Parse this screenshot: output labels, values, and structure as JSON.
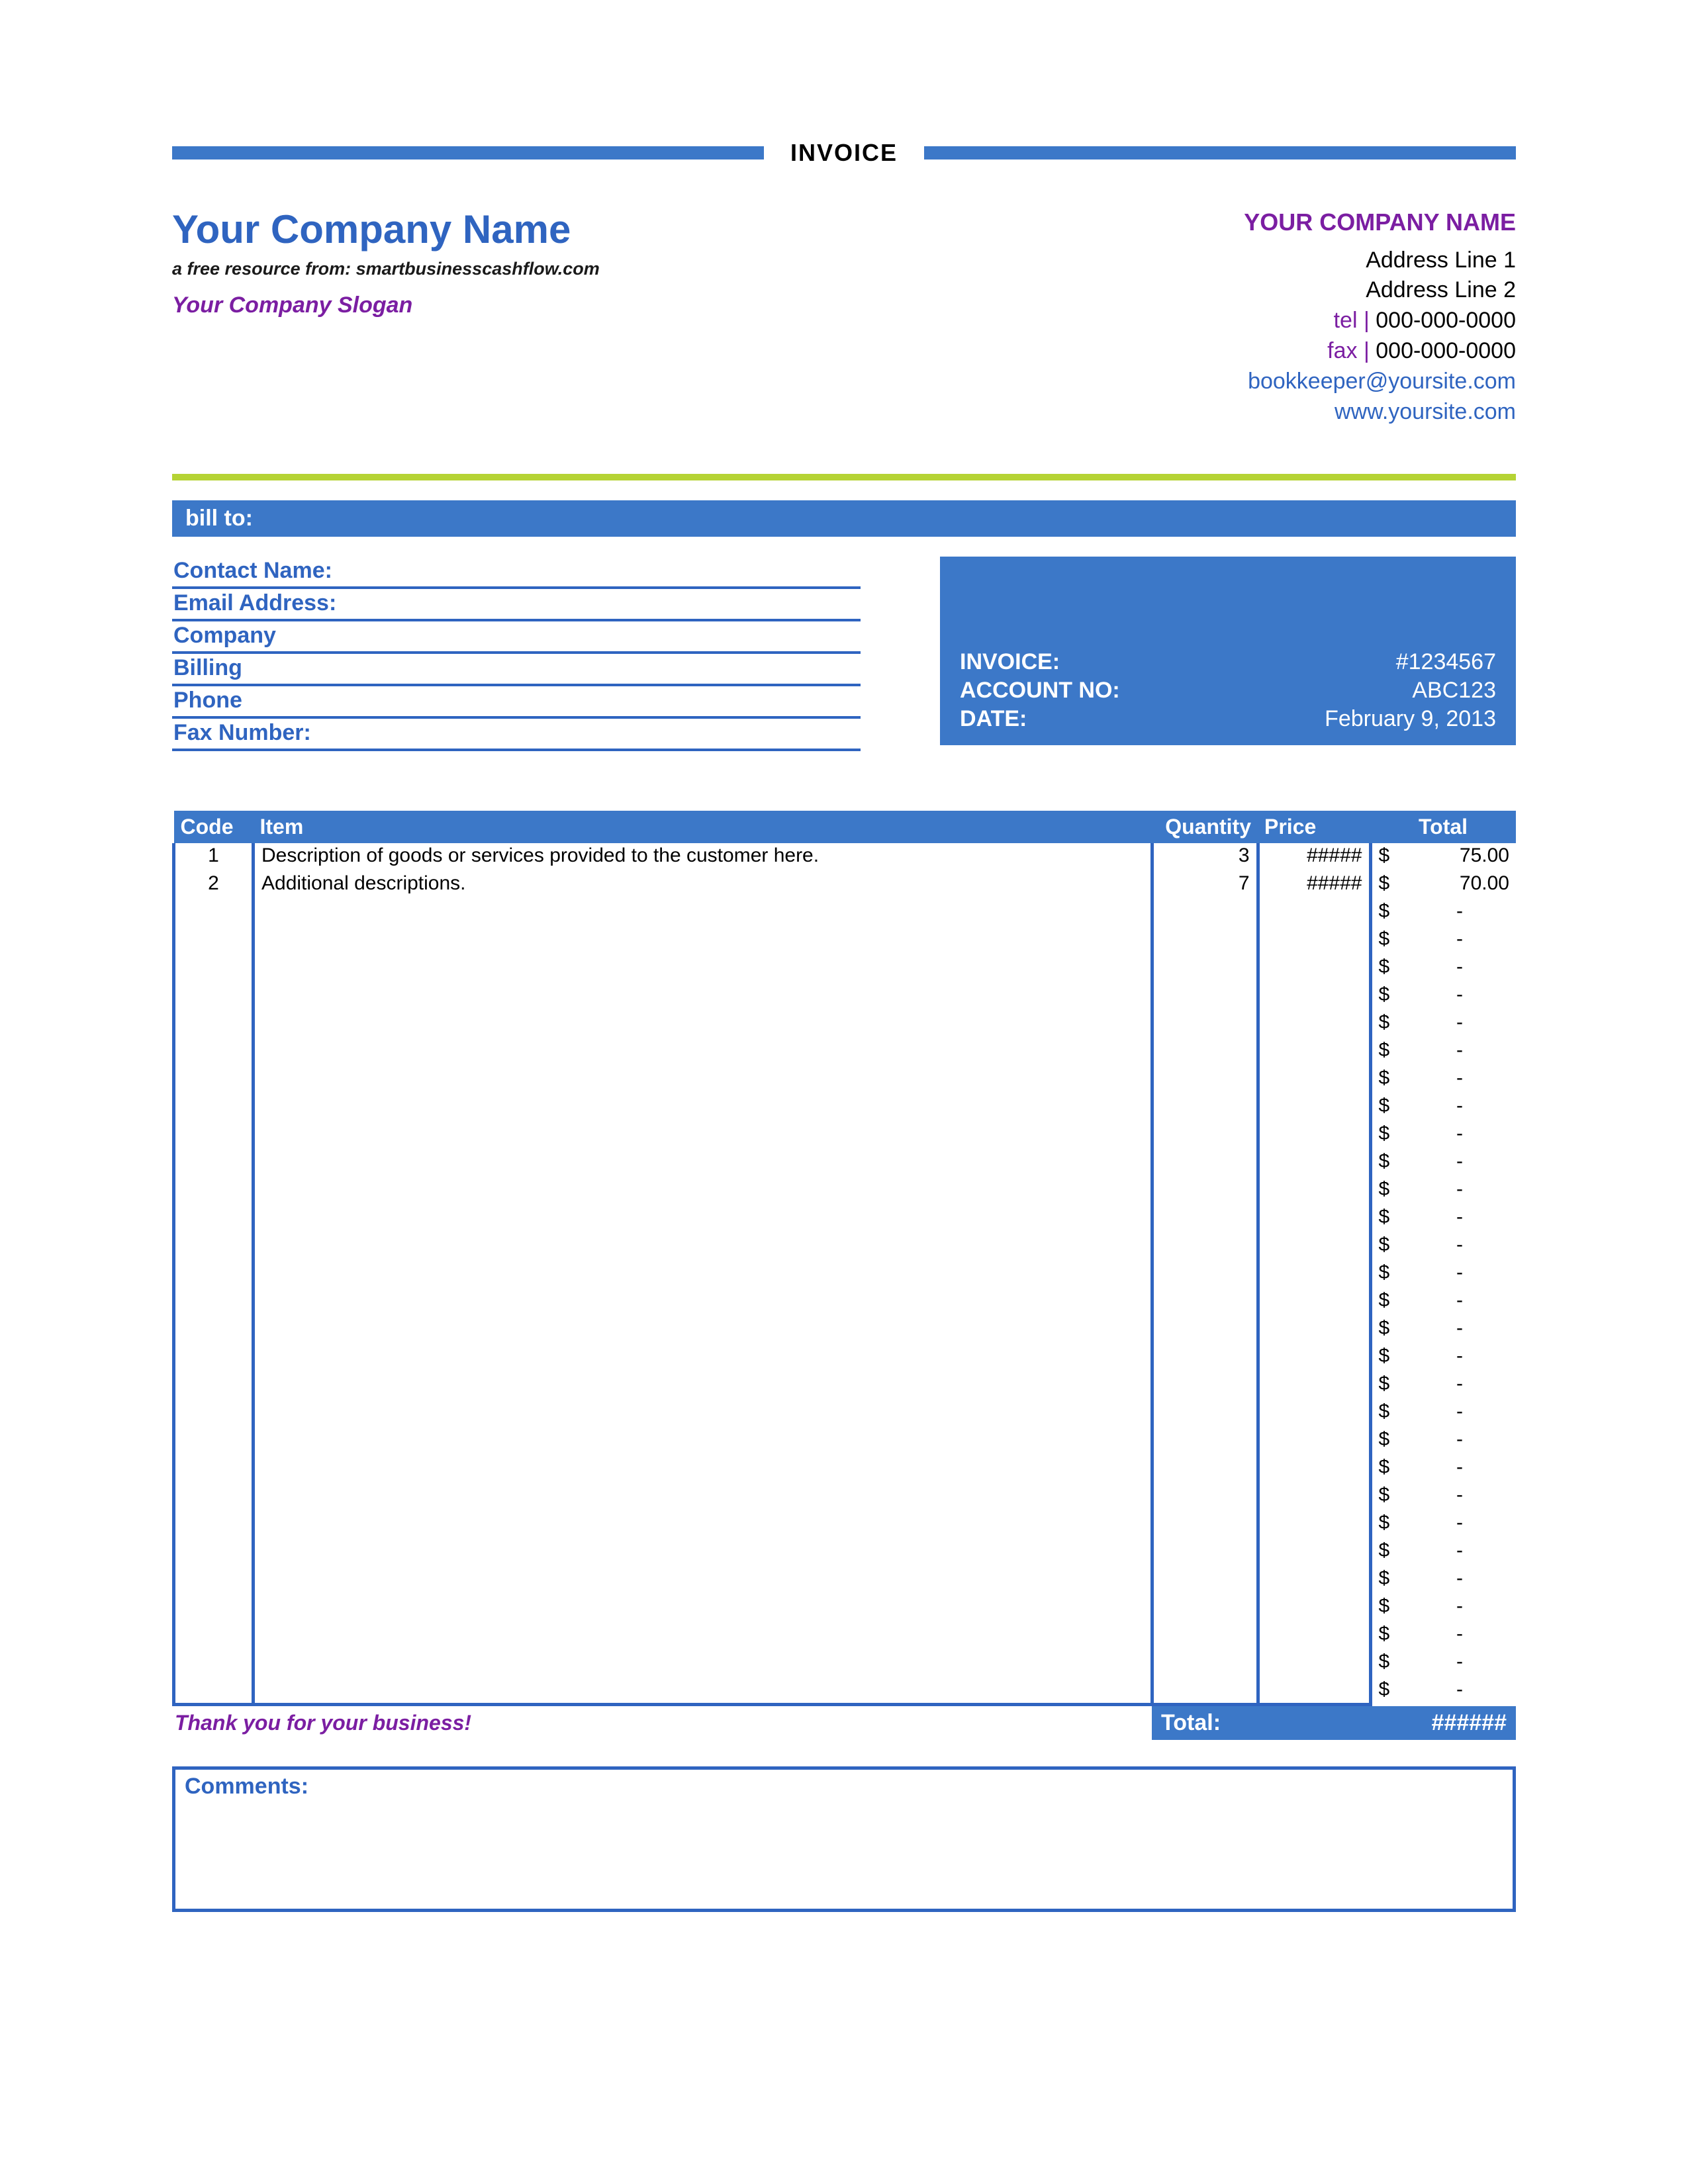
{
  "top_title": "INVOICE",
  "header": {
    "company_name": "Your Company Name",
    "resource_line": "a free resource from: smartbusinesscashflow.com",
    "slogan": "Your Company Slogan",
    "right_company": "YOUR COMPANY NAME",
    "address1": "Address Line 1",
    "address2": "Address Line 2",
    "tel_label": "tel",
    "tel": "000-000-0000",
    "fax_label": "fax",
    "fax": "000-000-0000",
    "email": "bookkeeper@yoursite.com",
    "website": "www.yoursite.com"
  },
  "billto_label": "bill to:",
  "bill_fields": [
    "Contact Name:",
    "Email Address:",
    "Company",
    "Billing",
    "Phone",
    "Fax Number:"
  ],
  "invoice_info": {
    "invoice_label": "INVOICE:",
    "invoice_value": "#1234567",
    "account_label": "ACCOUNT NO:",
    "account_value": "ABC123",
    "date_label": "DATE:",
    "date_value": "February 9, 2013"
  },
  "table": {
    "headers": {
      "code": "Code",
      "item": "Item",
      "quantity": "Quantity",
      "price": "Price",
      "total": "Total"
    },
    "rows": [
      {
        "code": "1",
        "item": "Description of goods or services provided to the customer here.",
        "qty": "3",
        "price": "#####",
        "cur": "$",
        "total": "75.00"
      },
      {
        "code": "2",
        "item": "Additional descriptions.",
        "qty": "7",
        "price": "#####",
        "cur": "$",
        "total": "70.00"
      },
      {
        "code": "",
        "item": "",
        "qty": "",
        "price": "",
        "cur": "$",
        "total": "-"
      },
      {
        "code": "",
        "item": "",
        "qty": "",
        "price": "",
        "cur": "$",
        "total": "-"
      },
      {
        "code": "",
        "item": "",
        "qty": "",
        "price": "",
        "cur": "$",
        "total": "-"
      },
      {
        "code": "",
        "item": "",
        "qty": "",
        "price": "",
        "cur": "$",
        "total": "-"
      },
      {
        "code": "",
        "item": "",
        "qty": "",
        "price": "",
        "cur": "$",
        "total": "-"
      },
      {
        "code": "",
        "item": "",
        "qty": "",
        "price": "",
        "cur": "$",
        "total": "-"
      },
      {
        "code": "",
        "item": "",
        "qty": "",
        "price": "",
        "cur": "$",
        "total": "-"
      },
      {
        "code": "",
        "item": "",
        "qty": "",
        "price": "",
        "cur": "$",
        "total": "-"
      },
      {
        "code": "",
        "item": "",
        "qty": "",
        "price": "",
        "cur": "$",
        "total": "-"
      },
      {
        "code": "",
        "item": "",
        "qty": "",
        "price": "",
        "cur": "$",
        "total": "-"
      },
      {
        "code": "",
        "item": "",
        "qty": "",
        "price": "",
        "cur": "$",
        "total": "-"
      },
      {
        "code": "",
        "item": "",
        "qty": "",
        "price": "",
        "cur": "$",
        "total": "-"
      },
      {
        "code": "",
        "item": "",
        "qty": "",
        "price": "",
        "cur": "$",
        "total": "-"
      },
      {
        "code": "",
        "item": "",
        "qty": "",
        "price": "",
        "cur": "$",
        "total": "-"
      },
      {
        "code": "",
        "item": "",
        "qty": "",
        "price": "",
        "cur": "$",
        "total": "-"
      },
      {
        "code": "",
        "item": "",
        "qty": "",
        "price": "",
        "cur": "$",
        "total": "-"
      },
      {
        "code": "",
        "item": "",
        "qty": "",
        "price": "",
        "cur": "$",
        "total": "-"
      },
      {
        "code": "",
        "item": "",
        "qty": "",
        "price": "",
        "cur": "$",
        "total": "-"
      },
      {
        "code": "",
        "item": "",
        "qty": "",
        "price": "",
        "cur": "$",
        "total": "-"
      },
      {
        "code": "",
        "item": "",
        "qty": "",
        "price": "",
        "cur": "$",
        "total": "-"
      },
      {
        "code": "",
        "item": "",
        "qty": "",
        "price": "",
        "cur": "$",
        "total": "-"
      },
      {
        "code": "",
        "item": "",
        "qty": "",
        "price": "",
        "cur": "$",
        "total": "-"
      },
      {
        "code": "",
        "item": "",
        "qty": "",
        "price": "",
        "cur": "$",
        "total": "-"
      },
      {
        "code": "",
        "item": "",
        "qty": "",
        "price": "",
        "cur": "$",
        "total": "-"
      },
      {
        "code": "",
        "item": "",
        "qty": "",
        "price": "",
        "cur": "$",
        "total": "-"
      },
      {
        "code": "",
        "item": "",
        "qty": "",
        "price": "",
        "cur": "$",
        "total": "-"
      },
      {
        "code": "",
        "item": "",
        "qty": "",
        "price": "",
        "cur": "$",
        "total": "-"
      },
      {
        "code": "",
        "item": "",
        "qty": "",
        "price": "",
        "cur": "$",
        "total": "-"
      },
      {
        "code": "",
        "item": "",
        "qty": "",
        "price": "",
        "cur": "$",
        "total": "-"
      }
    ],
    "thanks": "Thank you for your business!",
    "total_label": "Total:",
    "total_value": "######"
  },
  "comments_label": "Comments:"
}
